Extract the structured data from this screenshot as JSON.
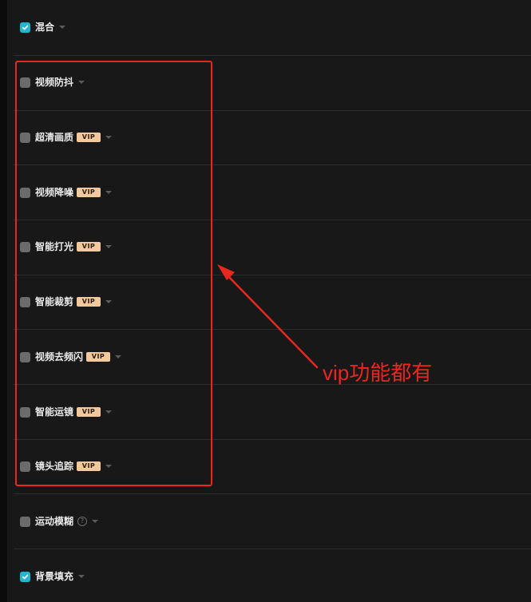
{
  "colors": {
    "checkbox_on": "#1fb8d0",
    "checkbox_off": "#6b6b6b",
    "vip_badge": "#f1c99c",
    "annotation": "#e8281e"
  },
  "items": [
    {
      "label": "混合",
      "checked": true,
      "vip": false,
      "help": false
    },
    {
      "label": "视频防抖",
      "checked": false,
      "vip": false,
      "help": false
    },
    {
      "label": "超清画质",
      "checked": false,
      "vip": true,
      "help": false
    },
    {
      "label": "视频降噪",
      "checked": false,
      "vip": true,
      "help": false
    },
    {
      "label": "智能打光",
      "checked": false,
      "vip": true,
      "help": false
    },
    {
      "label": "智能裁剪",
      "checked": false,
      "vip": true,
      "help": false
    },
    {
      "label": "视频去频闪",
      "checked": false,
      "vip": true,
      "help": false
    },
    {
      "label": "智能运镜",
      "checked": false,
      "vip": true,
      "help": false
    },
    {
      "label": "镜头追踪",
      "checked": false,
      "vip": true,
      "help": false
    },
    {
      "label": "运动模糊",
      "checked": false,
      "vip": false,
      "help": true
    },
    {
      "label": "背景填充",
      "checked": true,
      "vip": false,
      "help": false
    }
  ],
  "badge_text": "VIP",
  "help_icon_glyph": "?",
  "annotation": {
    "text": "vip功能都有"
  }
}
